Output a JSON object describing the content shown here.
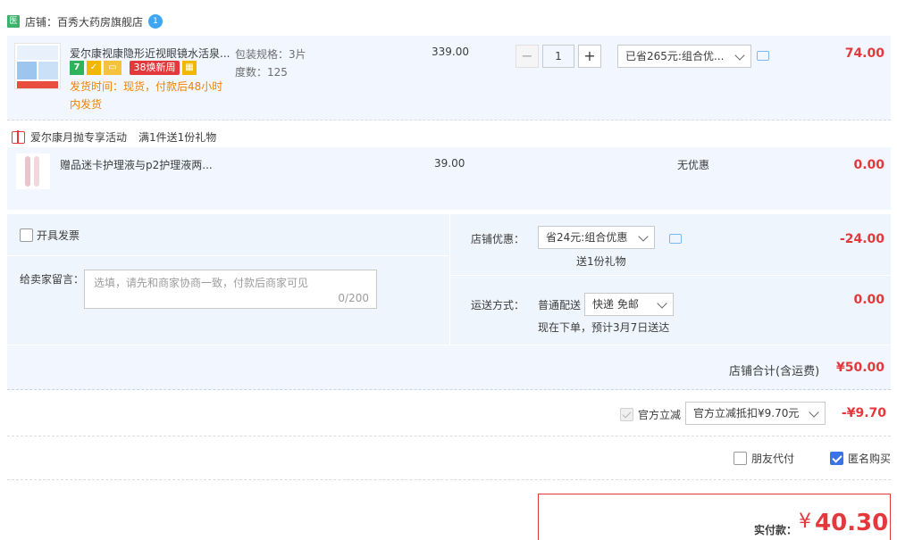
{
  "shop": {
    "icon_text": "医",
    "label": "店铺：百秀大药房旗舰店",
    "badge": "1"
  },
  "item1": {
    "title": "爱尔康视康隐形近视眼镜水活泉...",
    "tags": {
      "seven": "7",
      "promo": "38焕新周"
    },
    "shipping": "发货时间：现货，付款后48小时内发货",
    "spec_pack": "包装规格：3片",
    "spec_degree": "度数：125",
    "price": "339.00",
    "quantity": "1",
    "minus": "−",
    "plus": "+",
    "discount_select": "已省265元:组合优...",
    "amount": "74.00"
  },
  "gift": {
    "heading": "爱尔康月抛专享活动",
    "rule": "满1件送1份礼物",
    "title": "赠品迷卡护理液与p2护理液两...",
    "price": "39.00",
    "discount": "无优惠",
    "amount": "0.00"
  },
  "invoice": {
    "label": "开具发票"
  },
  "message": {
    "label": "给卖家留言：",
    "placeholder": "选填，请先和商家协商一致，付款后商家可见",
    "counter": "0/200"
  },
  "store_discount": {
    "label": "店铺优惠：",
    "select": "省24元:组合优惠",
    "note": "送1份礼物",
    "amount": "-24.00"
  },
  "delivery": {
    "label": "运送方式：",
    "method": "普通配送",
    "select": "快递 免邮",
    "note": "现在下单，预计3月7日送达",
    "amount": "0.00"
  },
  "subtotal": {
    "label": "店铺合计(含运费)",
    "amount": "¥50.00"
  },
  "official": {
    "label": "官方立减",
    "select": "官方立减抵扣¥9.70元",
    "amount": "-¥9.70"
  },
  "options": {
    "friend_pay": "朋友代付",
    "anonymous": "匿名购买"
  },
  "payment": {
    "label": "实付款：",
    "currency": "¥",
    "amount": "40.30"
  }
}
